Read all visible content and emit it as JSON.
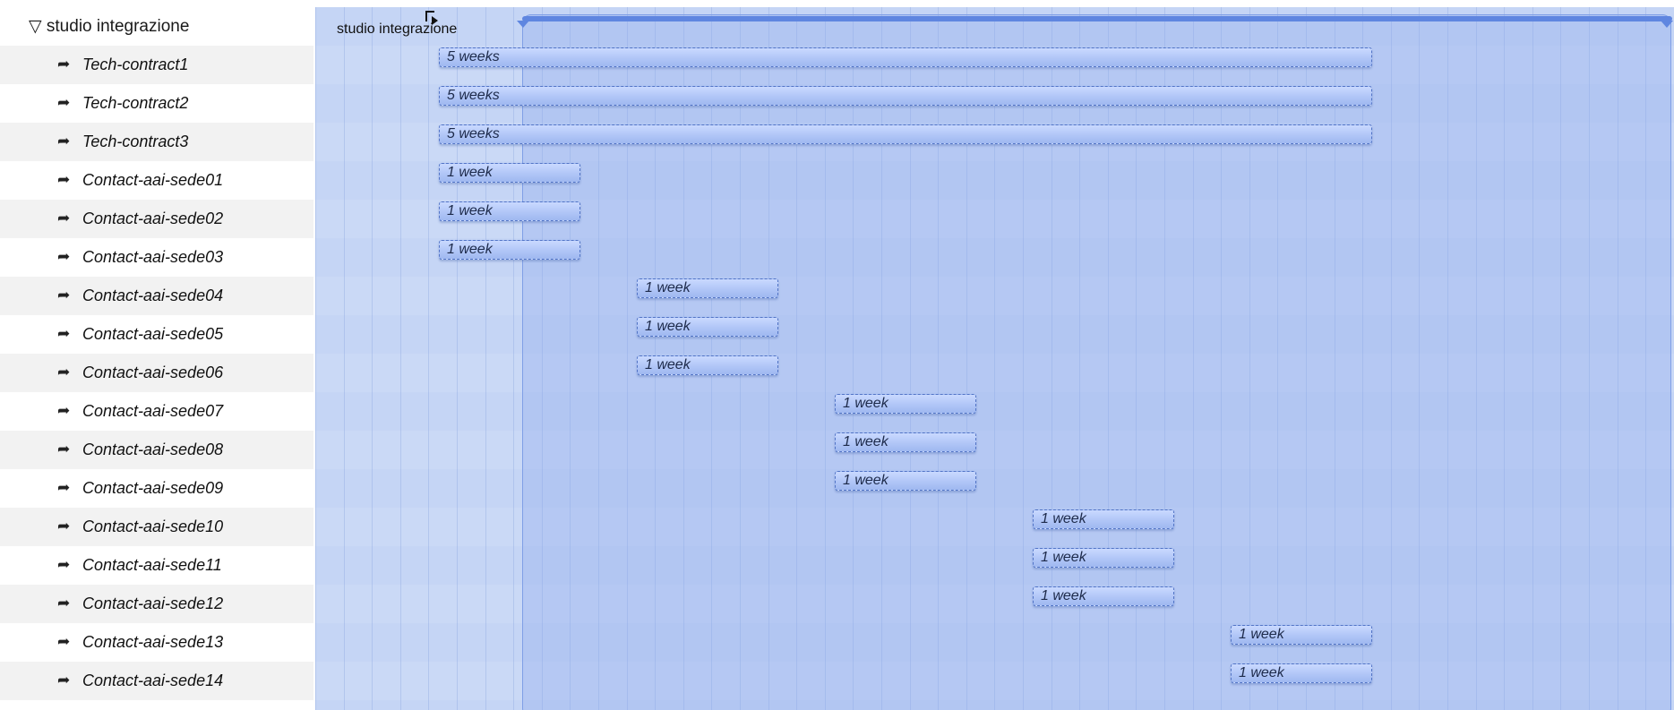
{
  "outline": {
    "group": {
      "label": "studio integrazione",
      "expander_glyph": "▽"
    },
    "task_icon_glyph": "➦",
    "tasks": [
      "Tech-contract1",
      "Tech-contract2",
      "Tech-contract3",
      "Contact-aai-sede01",
      "Contact-aai-sede02",
      "Contact-aai-sede03",
      "Contact-aai-sede04",
      "Contact-aai-sede05",
      "Contact-aai-sede06",
      "Contact-aai-sede07",
      "Contact-aai-sede08",
      "Contact-aai-sede09",
      "Contact-aai-sede10",
      "Contact-aai-sede11",
      "Contact-aai-sede12",
      "Contact-aai-sede13",
      "Contact-aai-sede14"
    ]
  },
  "gantt": {
    "group_label": "studio integrazione",
    "colors": {
      "bar": "#b1c6f7",
      "bar_border": "#5274c6",
      "summary": "#5f86e0",
      "background": "#c5d5f5"
    },
    "durations": [
      "5 weeks",
      "5 weeks",
      "5 weeks",
      "1 week",
      "1 week",
      "1 week",
      "1 week",
      "1 week",
      "1 week",
      "1 week",
      "1 week",
      "1 week",
      "1 week",
      "1 week",
      "1 week",
      "1 week",
      "1 week"
    ]
  }
}
